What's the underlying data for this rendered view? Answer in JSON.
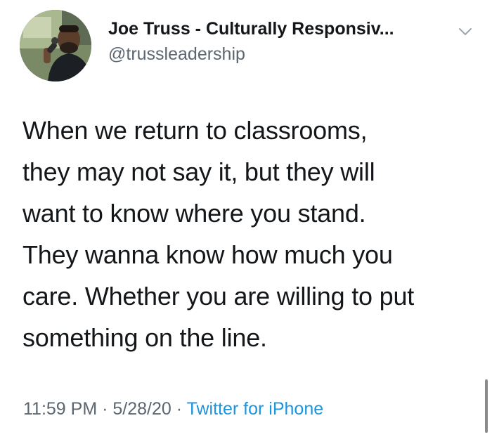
{
  "author": {
    "display_name": "Joe Truss - Culturally Responsiv...",
    "handle": "@trussleadership"
  },
  "tweet": {
    "lines": [
      "When we return to classrooms,",
      "they may not say it, but they will",
      "want to know where you stand.",
      "They wanna know how much you",
      "care. Whether you are willing to put",
      "something on the line."
    ]
  },
  "meta": {
    "time": "11:59 PM",
    "separator": "·",
    "date": "5/28/20",
    "source": "Twitter for iPhone"
  },
  "colors": {
    "text": "#14171a",
    "secondary": "#5b6671",
    "link": "#1b95e0"
  },
  "icons": {
    "avatar": "profile-photo",
    "menu": "chevron-down-icon"
  }
}
